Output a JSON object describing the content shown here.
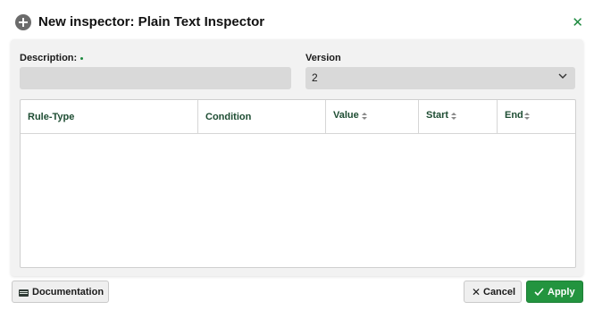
{
  "dialog": {
    "title": "New inspector: Plain Text Inspector",
    "header_icon": "plus-circle-icon",
    "close_icon": "close-icon",
    "close_glyph": "✕",
    "accent_color": "#23943f"
  },
  "form": {
    "description": {
      "label": "Description:",
      "value": "",
      "required": true
    },
    "version": {
      "label": "Version",
      "value": "2",
      "icon": "chevron-down-icon"
    }
  },
  "table": {
    "columns": [
      {
        "label": "Rule-Type",
        "sortable": false
      },
      {
        "label": "Condition",
        "sortable": false
      },
      {
        "label": "Value",
        "sortable": true
      },
      {
        "label": "Start",
        "sortable": true
      },
      {
        "label": "End",
        "sortable": true
      }
    ],
    "rows": []
  },
  "footer": {
    "documentation_label": "Documentation",
    "documentation_icon": "book-icon",
    "cancel_label": "Cancel",
    "cancel_icon": "close-icon",
    "cancel_glyph": "✕",
    "apply_label": "Apply",
    "apply_icon": "check-icon"
  }
}
